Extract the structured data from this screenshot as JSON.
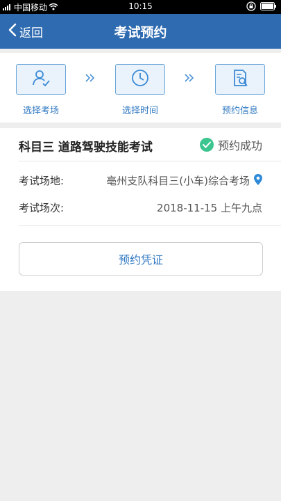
{
  "status_bar": {
    "carrier": "中国移动",
    "time": "10:15"
  },
  "nav": {
    "back_label": "返回",
    "title": "考试预约"
  },
  "steps": [
    {
      "label": "选择考场",
      "icon": "person-check-icon"
    },
    {
      "label": "选择时间",
      "icon": "clock-icon"
    },
    {
      "label": "预约信息",
      "icon": "document-search-icon"
    }
  ],
  "exam": {
    "title": "科目三 道路驾驶技能考试",
    "status": "预约成功",
    "location_label": "考试场地:",
    "location_value": "亳州支队科目三(小车)综合考场",
    "session_label": "考试场次:",
    "session_value": "2018-11-15 上午九点"
  },
  "voucher_button": "预约凭证",
  "colors": {
    "primary": "#2f6bb0",
    "accent": "#2f78c2",
    "success": "#3cc58f",
    "background": "#eeeeee"
  }
}
